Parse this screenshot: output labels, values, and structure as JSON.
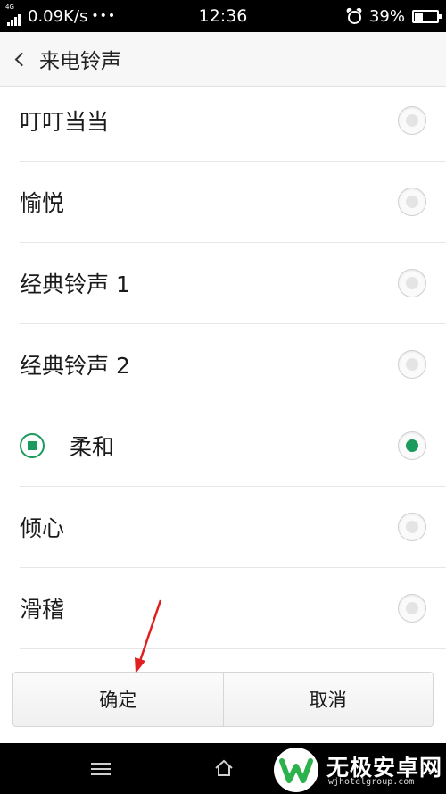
{
  "status_bar": {
    "network": "4G",
    "speed": "0.09K/s",
    "dots": "•••",
    "time": "12:36",
    "battery": "39%",
    "battery_level": 0.39
  },
  "header": {
    "title": "来电铃声"
  },
  "ringtones": [
    {
      "label": "叮叮当当",
      "selected": false,
      "playing": false
    },
    {
      "label": "愉悦",
      "selected": false,
      "playing": false
    },
    {
      "label": "经典铃声 1",
      "selected": false,
      "playing": false
    },
    {
      "label": "经典铃声 2",
      "selected": false,
      "playing": false
    },
    {
      "label": "柔和",
      "selected": true,
      "playing": true
    },
    {
      "label": "倾心",
      "selected": false,
      "playing": false
    },
    {
      "label": "滑稽",
      "selected": false,
      "playing": false
    }
  ],
  "buttons": {
    "confirm": "确定",
    "cancel": "取消"
  },
  "watermark": {
    "name": "无极安卓网",
    "url": "wjhotelgroup.com"
  },
  "colors": {
    "accent": "#1a9a5c",
    "annotation_arrow": "#e02020"
  }
}
